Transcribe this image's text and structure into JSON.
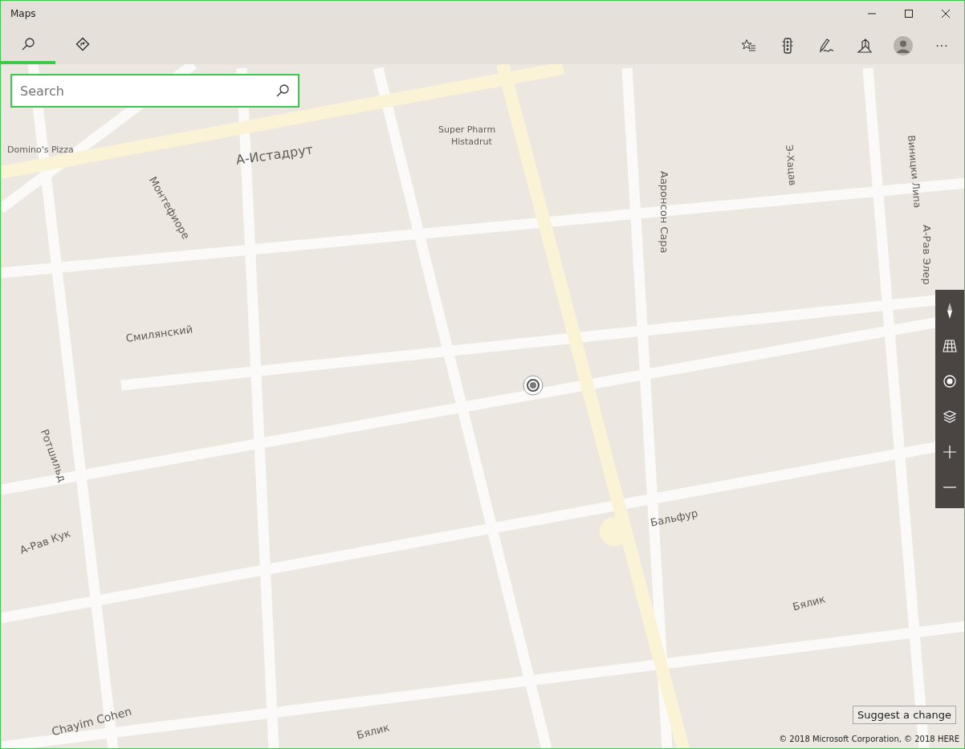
{
  "window": {
    "title": "Maps"
  },
  "tabs": [
    {
      "kind": "search",
      "selected": true
    },
    {
      "kind": "directions",
      "selected": false
    }
  ],
  "toolbar": [
    {
      "kind": "favorites"
    },
    {
      "kind": "traffic"
    },
    {
      "kind": "ink"
    },
    {
      "kind": "landmarks"
    },
    {
      "kind": "account"
    },
    {
      "kind": "more",
      "label": "···"
    }
  ],
  "search": {
    "placeholder": "Search"
  },
  "map_labels": [
    {
      "text": "Domino's Pizza"
    },
    {
      "text": "А-Истадрут"
    },
    {
      "text": "Super Pharm"
    },
    {
      "text": "Histadrut"
    },
    {
      "text": "Монтефиоре"
    },
    {
      "text": "Ааронсон Сара"
    },
    {
      "text": "Э-Хацав"
    },
    {
      "text": "Виницки Липа"
    },
    {
      "text": "А-Рав Элер"
    },
    {
      "text": "Смилянский"
    },
    {
      "text": "Ротшильд"
    },
    {
      "text": "А-Рав Кук"
    },
    {
      "text": "Бальфур"
    },
    {
      "text": "Бялик"
    },
    {
      "text": "Бялик"
    },
    {
      "text": "Chayim Cohen"
    }
  ],
  "map_controls": [
    {
      "kind": "compass"
    },
    {
      "kind": "tilt"
    },
    {
      "kind": "locate"
    },
    {
      "kind": "layers"
    },
    {
      "kind": "zoom-in"
    },
    {
      "kind": "zoom-out"
    }
  ],
  "suggest_button": "Suggest a change",
  "copyright": "© 2018 Microsoft Corporation, © 2018 HERE"
}
